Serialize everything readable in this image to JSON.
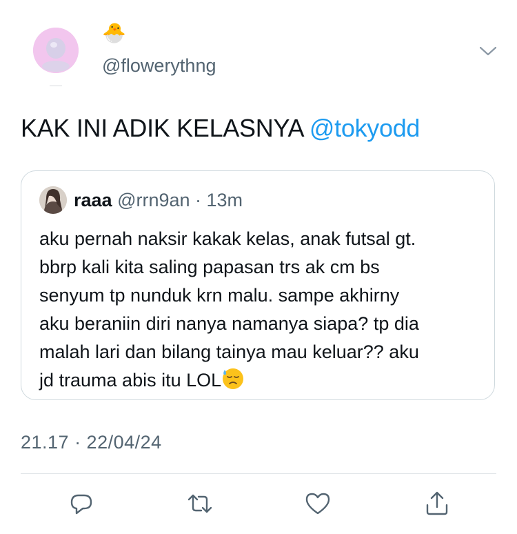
{
  "tweet": {
    "author_handle": "@flowerythng",
    "name_emoji": "🐣",
    "text_prefix": "KAK INI ADIK KELASNYA ",
    "text_mention": "@tokyodd",
    "timestamp": "21.17 · 22/04/24"
  },
  "quoted_tweet": {
    "display_name": "raaa",
    "handle_and_time": " @rrn9an · 13m",
    "lines": [
      "aku pernah naksir kakak kelas, anak futsal gt.",
      "bbrp kali kita saling papasan trs ak cm bs",
      "senyum tp nunduk krn malu. sampe akhirny",
      "aku beraniin diri nanya namanya siapa? tp dia",
      "malah lari dan bilang tainya mau keluar?? aku",
      "jd trauma abis itu LOL"
    ],
    "trailing_emoji": "downcast-face-with-sweat"
  },
  "actions": [
    "reply-icon",
    "retweet-icon",
    "like-icon",
    "share-icon"
  ],
  "colors": {
    "accent": "#1d9bf0",
    "muted": "#536471",
    "border": "#cfd9de"
  }
}
